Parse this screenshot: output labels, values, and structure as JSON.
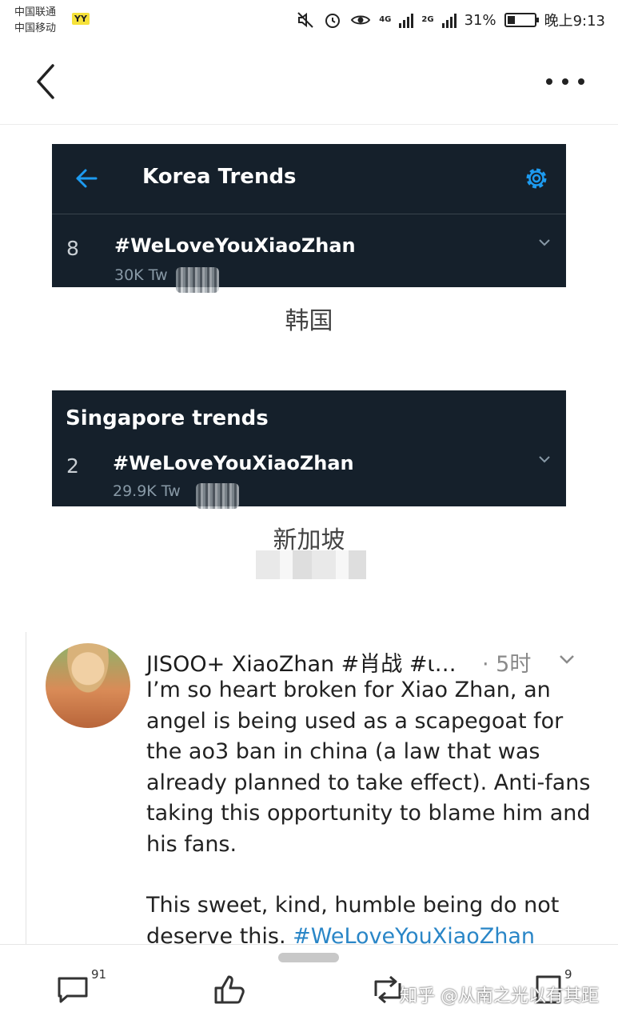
{
  "status_bar": {
    "carrier_1": "中国联通",
    "carrier_2": "中国移动",
    "yy_badge": "YY",
    "net_1": "4G",
    "net_2": "2G",
    "battery_percent": "31%",
    "battery_level": 0.31,
    "time": "晚上9:13"
  },
  "header": {
    "back_icon": "chevron-left-icon",
    "more_icon": "more-horizontal-icon"
  },
  "korea_card": {
    "title": "Korea Trends",
    "rank": "8",
    "hashtag": "#WeLoveYouXiaoZhan",
    "count": "30K Tw"
  },
  "korea_caption": "韩国",
  "singapore_card": {
    "title": "Singapore trends",
    "rank": "2",
    "hashtag": "#WeLoveYouXiaoZhan",
    "count": "29.9K Tw"
  },
  "singapore_caption": "新加坡",
  "tweet": {
    "name": "JISOO+ XiaoZhan #肖战 #ι…",
    "time": "· 5时",
    "para1": "I’m so heart broken for Xiao Zhan, an angel is being used as a scapegoat for the ao3 ban in china (a law that was already planned to take effect). Anti-fans taking this opportunity to blame him and his fans.",
    "para2_text": "This sweet, kind, humble being do not deserve this. ",
    "para2_hashtag": "#WeLoveYouXiaoZhan"
  },
  "bottom_bar": {
    "comment_count": "91",
    "share_count": "9",
    "watermark": "知乎 @从南之光以有其距"
  }
}
